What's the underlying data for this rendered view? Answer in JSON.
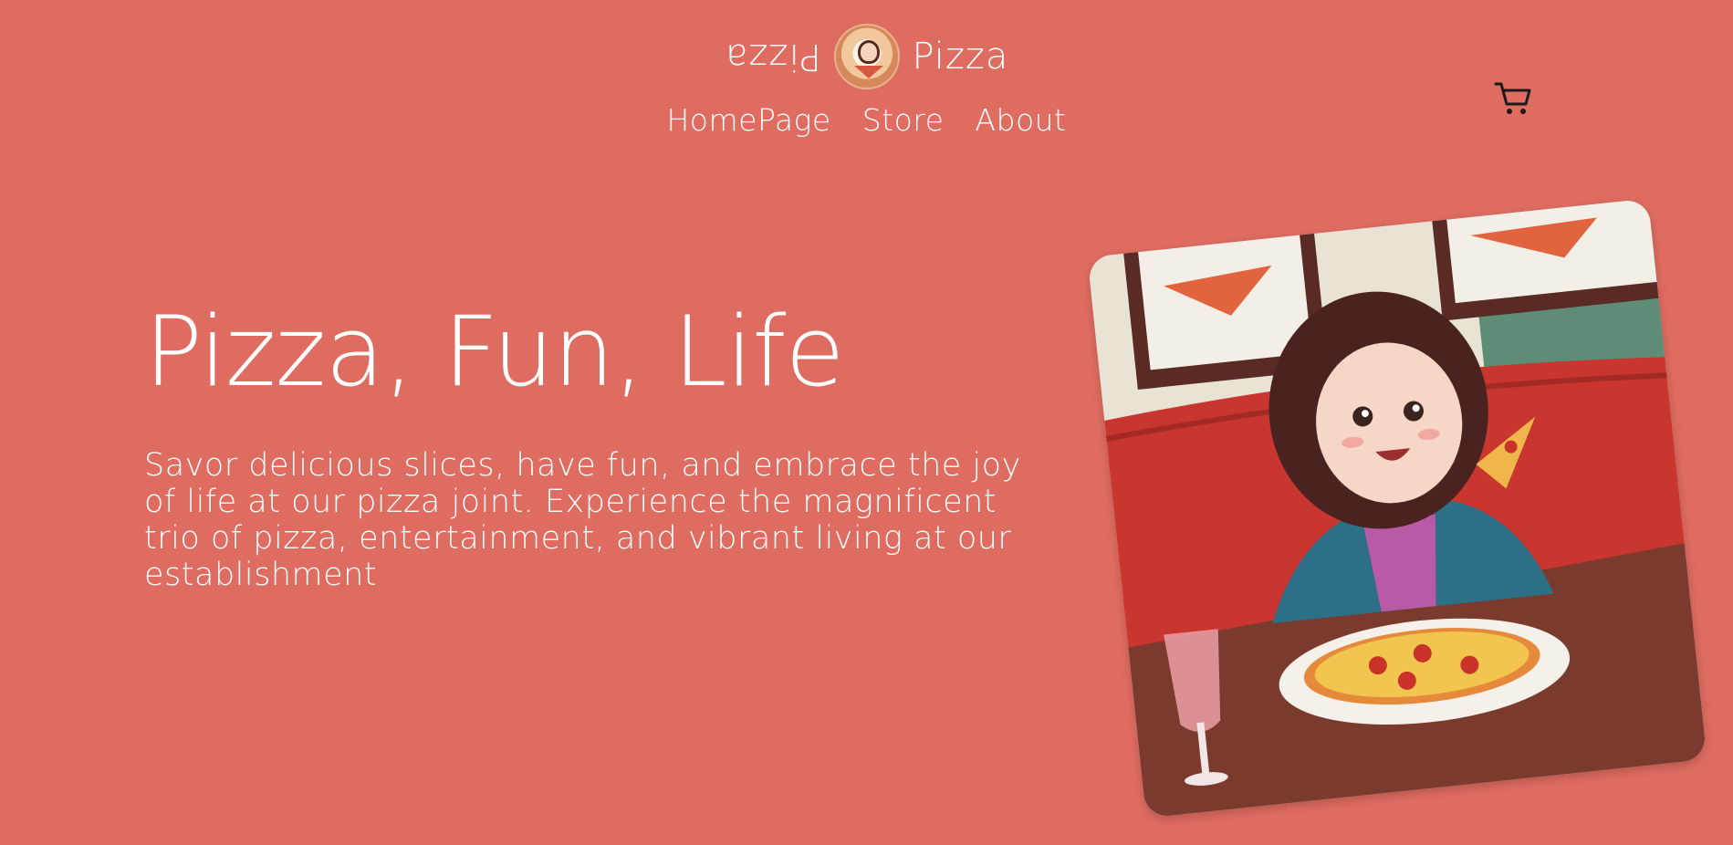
{
  "header": {
    "brand_left": "Pizza",
    "brand_right": "Pizza",
    "logo_icon": "pizza-girl-logo",
    "cart_icon": "shopping-cart-icon"
  },
  "nav": {
    "items": [
      {
        "label": "HomePage"
      },
      {
        "label": "Store"
      },
      {
        "label": "About"
      }
    ]
  },
  "hero": {
    "title": "Pizza, Fun, Life",
    "description": "Savor delicious slices, have fun, and embrace the joy of life at our pizza joint. Experience the magnificent trio of pizza, entertainment, and vibrant living at our establishment",
    "image_icon": "girl-eating-pizza-illustration"
  },
  "colors": {
    "background": "#df6c61",
    "text": "#ffffff",
    "cart": "#1a1a1a"
  }
}
